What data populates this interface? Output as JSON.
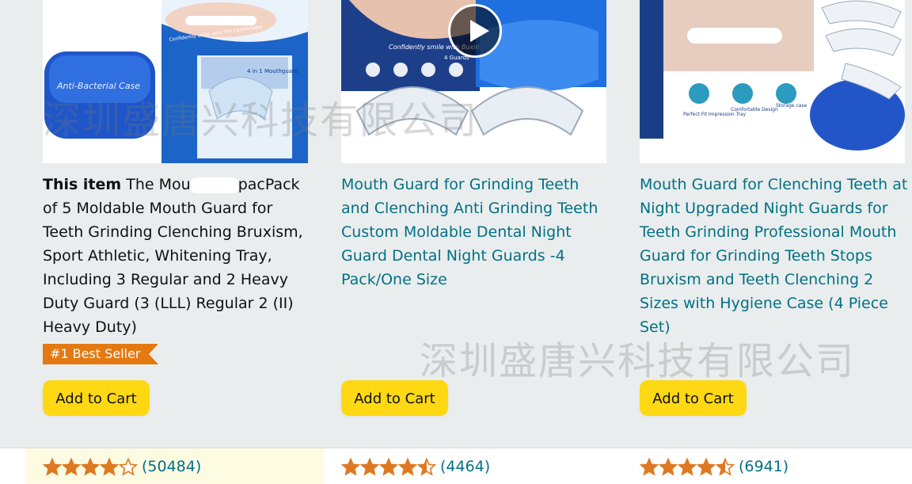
{
  "products": [
    {
      "this_item_label": "This item",
      "title_part1": "The Mou",
      "title_part2": "pacPack of 5 Moldable Mouth Guard for Teeth Grinding Clenching Bruxism, Sport Athletic, Whitening Tray, Including 3 Regular and 2 Heavy Duty Guard (3 (LLL) Regular 2 (II) Heavy Duty)",
      "badge": "#1 Best Seller",
      "image_text": [
        "Anti-Bacterial Case",
        "4 in 1 Mouthguard",
        "Confidently smile with The Comfortable"
      ],
      "cart_label": "Add to Cart",
      "rating": 4.0,
      "review_count": "(50484)"
    },
    {
      "title": "Mouth Guard for Grinding Teeth and Clenching Anti Grinding Teeth Custom Moldable Dental Night Guard Dental Night Guards -4 Pack/One Size",
      "image_text": [
        "Confidently smile with Buxin",
        "4 Guards"
      ],
      "cart_label": "Add to Cart",
      "rating": 4.5,
      "review_count": "(4464)"
    },
    {
      "title": "Mouth Guard for Clenching Teeth at Night Upgraded Night Guards for Teeth Grinding Professional Mouth Guard for Grinding Teeth Stops Bruxism and Teeth Clenching 2 Sizes with Hygiene Case (4 Piece Set)",
      "image_text": [
        "Perfect Fit Impression Tray",
        "Comfortable Design",
        "Storage case"
      ],
      "cart_label": "Add to Cart",
      "rating": 4.5,
      "review_count": "(6941)"
    }
  ],
  "watermark_text": "深圳盛唐兴科技有限公司",
  "colors": {
    "link": "#007185",
    "button": "#ffd814",
    "badge": "#e47911",
    "star": "#de7921"
  },
  "icons": [
    "play-icon",
    "star-icon",
    "half-star-icon",
    "empty-star-icon"
  ]
}
